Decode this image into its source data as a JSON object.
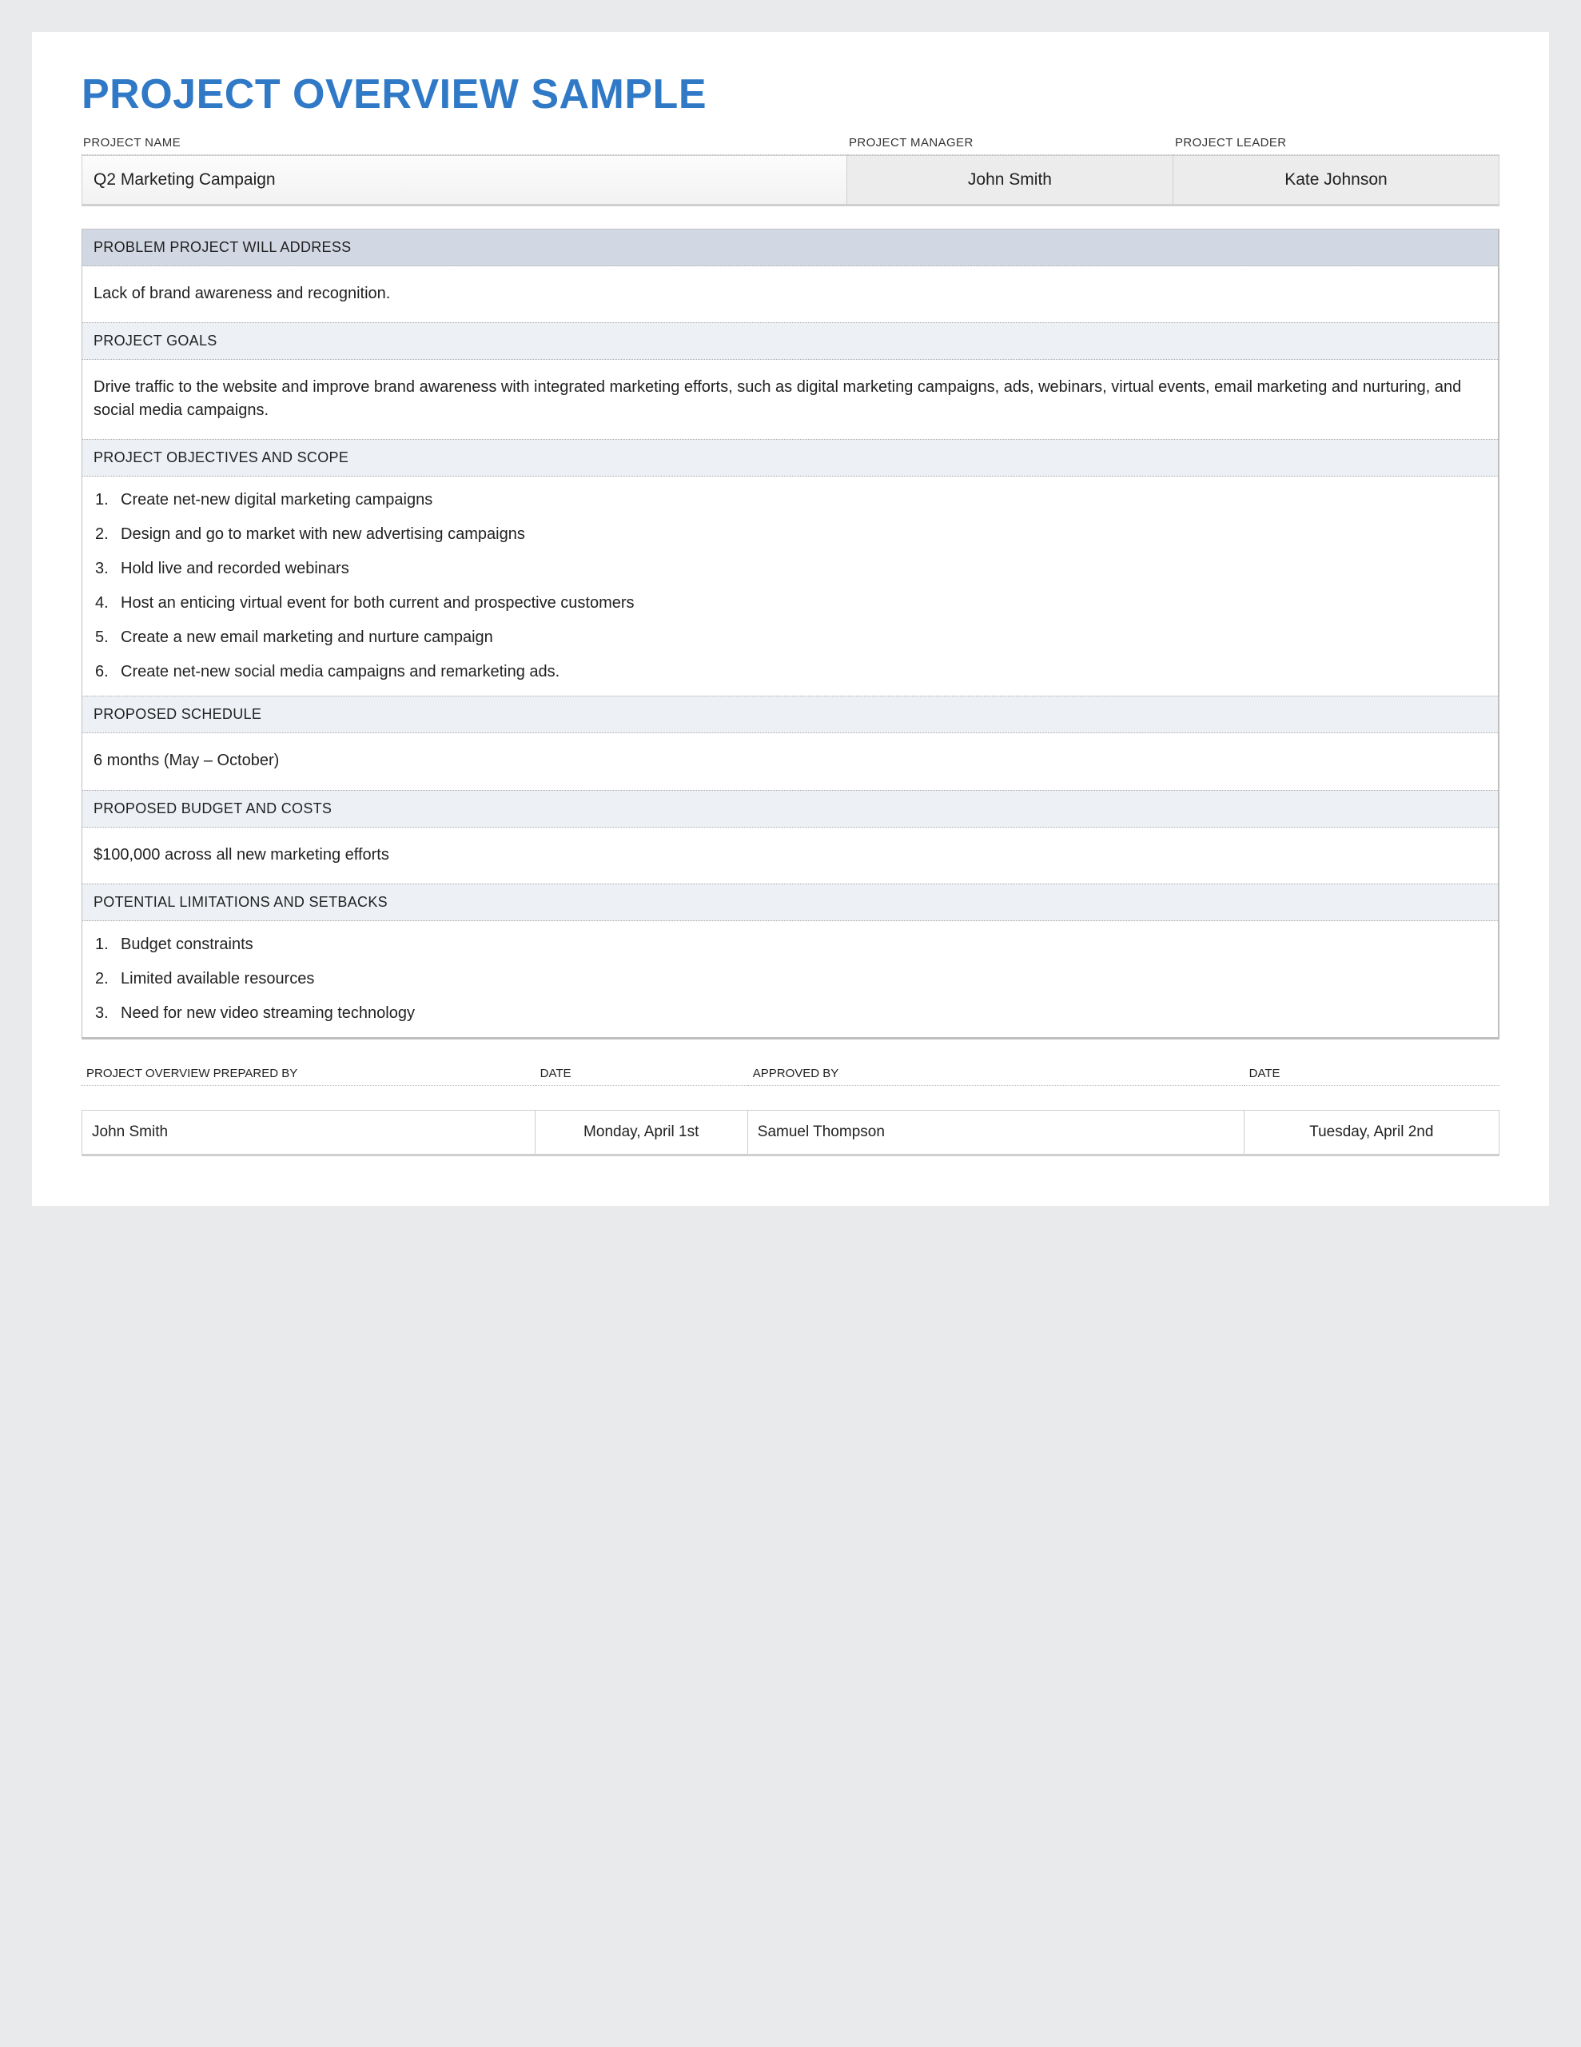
{
  "title": "PROJECT OVERVIEW SAMPLE",
  "header": {
    "name_label": "PROJECT NAME",
    "manager_label": "PROJECT MANAGER",
    "leader_label": "PROJECT LEADER",
    "name": "Q2 Marketing Campaign",
    "manager": "John Smith",
    "leader": "Kate Johnson"
  },
  "sections": {
    "problem": {
      "label": "PROBLEM PROJECT WILL ADDRESS",
      "body": "Lack of brand awareness and recognition."
    },
    "goals": {
      "label": "PROJECT GOALS",
      "body": "Drive traffic to the website and improve brand awareness with integrated marketing efforts, such as digital marketing campaigns, ads, webinars, virtual events, email marketing and nurturing, and social media campaigns."
    },
    "objectives": {
      "label": "PROJECT OBJECTIVES AND SCOPE",
      "items": [
        "Create net-new digital marketing campaigns",
        "Design and go to market with new advertising campaigns",
        "Hold live and recorded webinars",
        "Host an enticing virtual event for both current and prospective customers",
        "Create a new email marketing and nurture campaign",
        "Create net-new social media campaigns and remarketing ads."
      ]
    },
    "schedule": {
      "label": "PROPOSED SCHEDULE",
      "body": "6 months (May – October)"
    },
    "budget": {
      "label": "PROPOSED BUDGET AND COSTS",
      "body": "$100,000 across all new marketing efforts"
    },
    "limitations": {
      "label": "POTENTIAL LIMITATIONS AND SETBACKS",
      "items": [
        "Budget constraints",
        "Limited available resources",
        "Need for new video streaming technology"
      ]
    }
  },
  "footer": {
    "prepared_by_label": "PROJECT OVERVIEW PREPARED BY",
    "prepared_date_label": "DATE",
    "approved_by_label": "APPROVED BY",
    "approved_date_label": "DATE",
    "prepared_by": "John Smith",
    "prepared_date": "Monday, April 1st",
    "approved_by": "Samuel Thompson",
    "approved_date": "Tuesday, April 2nd"
  }
}
